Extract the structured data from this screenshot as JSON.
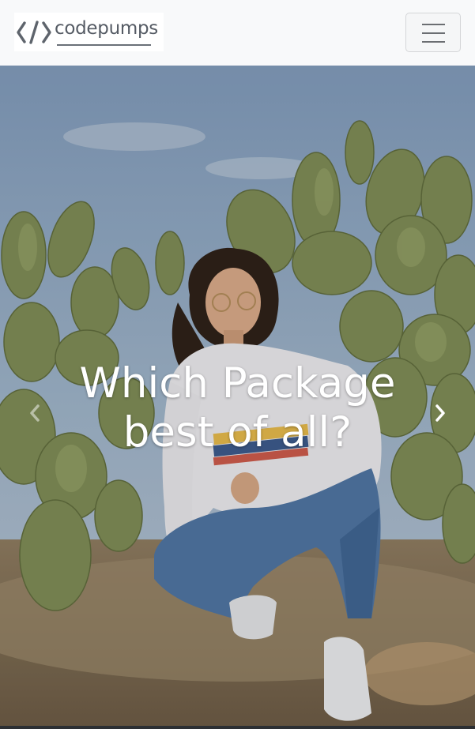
{
  "navbar": {
    "brand_text": "codepumps",
    "toggler_icon": "hamburger-icon"
  },
  "hero": {
    "caption_line1": "Which Package",
    "caption_line2": "best of all?",
    "prev_icon": "chevron-left-icon",
    "next_icon": "chevron-right-icon"
  },
  "colors": {
    "navbar_bg": "#f8f9fa",
    "brand_text": "#555b64",
    "caption_text": "#ffffff"
  }
}
